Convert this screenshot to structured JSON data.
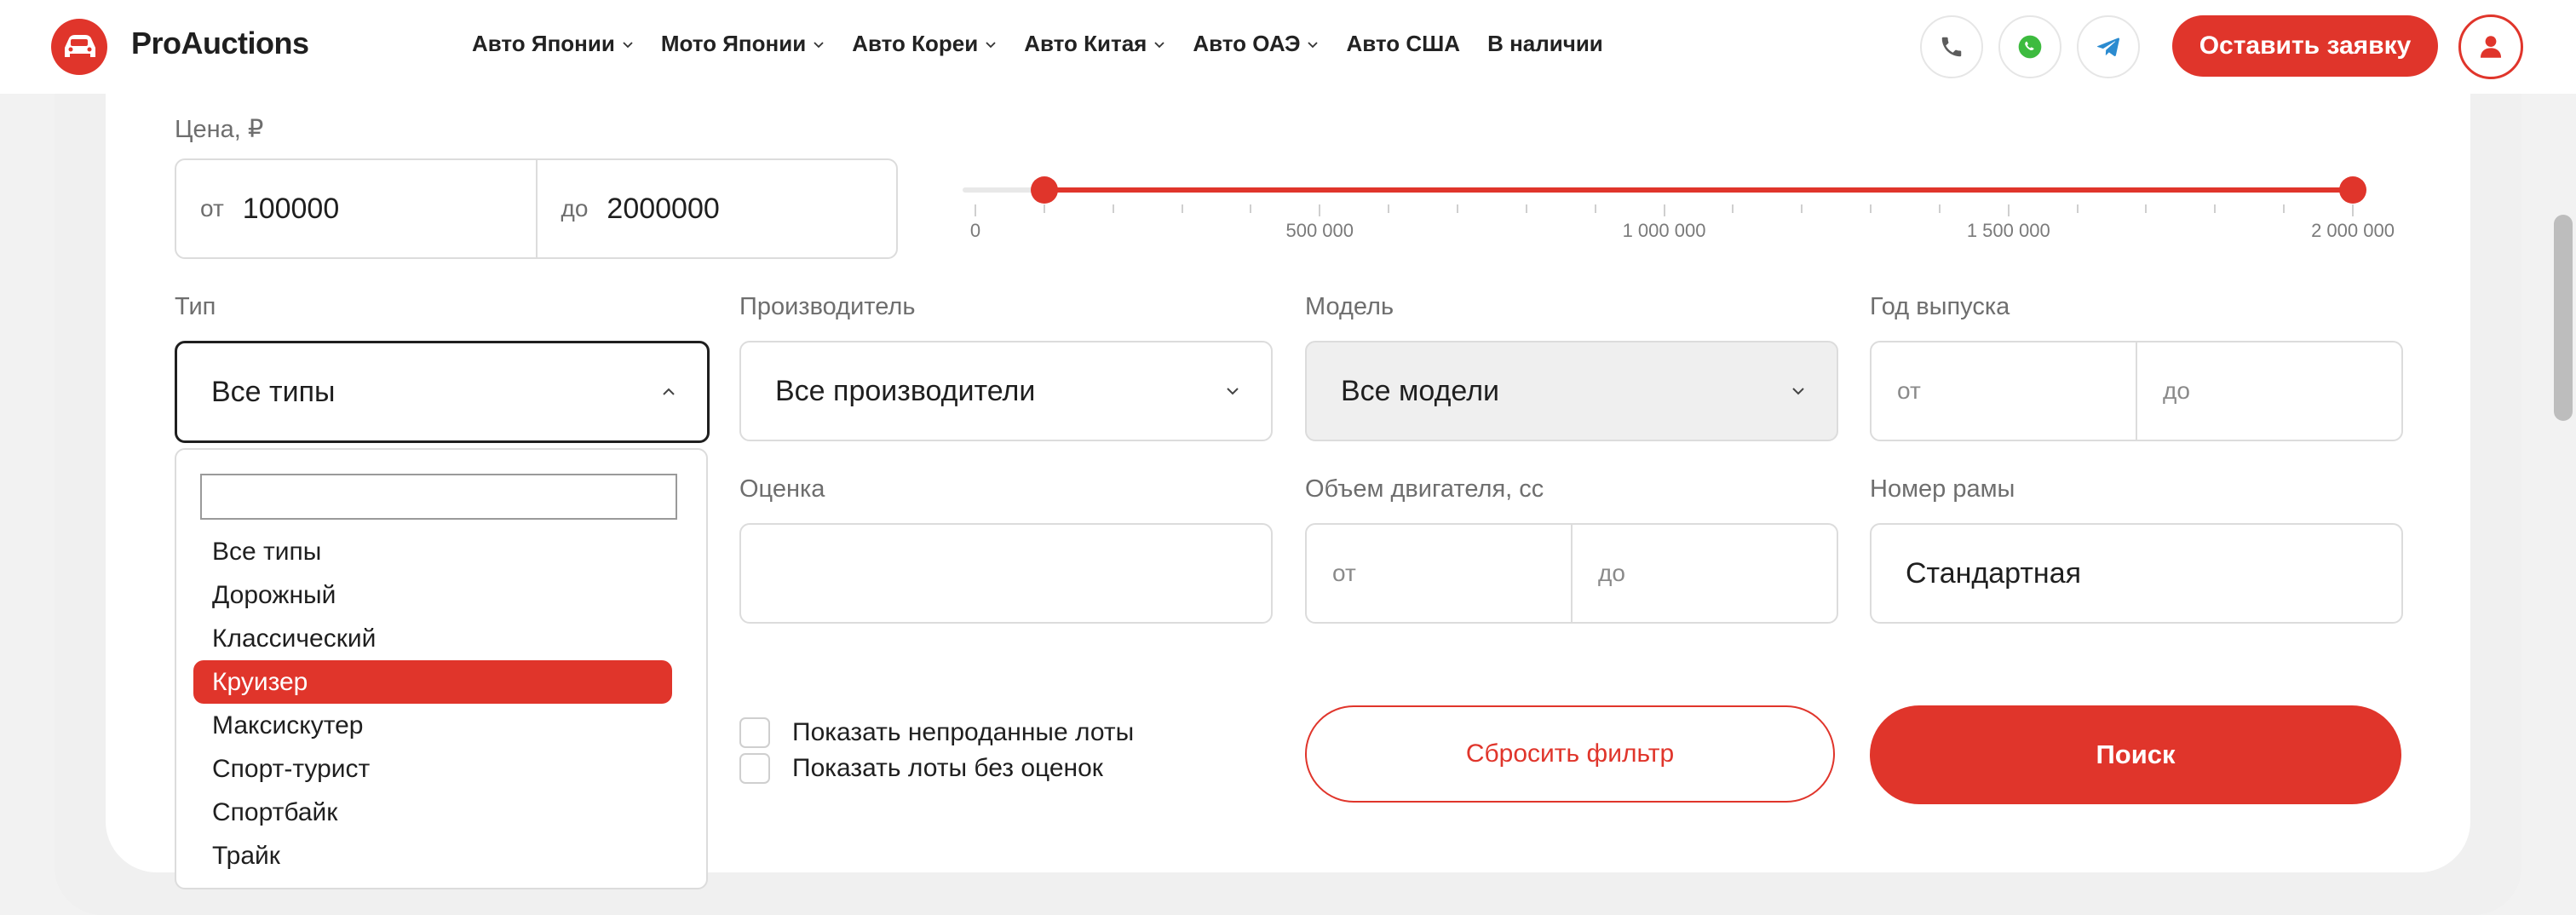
{
  "header": {
    "brand": "ProAuctions",
    "nav": [
      {
        "label": "Авто Японии",
        "dropdown": true
      },
      {
        "label": "Мото Японии",
        "dropdown": true
      },
      {
        "label": "Авто Кореи",
        "dropdown": true
      },
      {
        "label": "Авто Китая",
        "dropdown": true
      },
      {
        "label": "Авто ОАЭ",
        "dropdown": true
      },
      {
        "label": "Авто США",
        "dropdown": false
      },
      {
        "label": "В наличии",
        "dropdown": false
      }
    ],
    "contact_icons": [
      "phone-icon",
      "whatsapp-icon",
      "telegram-icon"
    ],
    "cta_label": "Оставить заявку"
  },
  "filters": {
    "price": {
      "label": "Цена, ₽",
      "from_prefix": "от",
      "from_value": "100000",
      "to_prefix": "до",
      "to_value": "2000000"
    },
    "slider": {
      "min": 0,
      "max": 2000000,
      "low": 100000,
      "high": 2000000,
      "tick_labels": [
        "0",
        "500 000",
        "1 000 000",
        "1 500 000",
        "2 000 000"
      ]
    },
    "type": {
      "label": "Тип",
      "value": "Все типы",
      "open": true
    },
    "manufacturer": {
      "label": "Производитель",
      "value": "Все производители"
    },
    "model": {
      "label": "Модель",
      "value": "Все модели",
      "disabled": true
    },
    "year": {
      "label": "Год выпуска",
      "from_placeholder": "от",
      "to_placeholder": "до"
    },
    "grade": {
      "label": "Оценка",
      "value": ""
    },
    "engine": {
      "label": "Объем двигателя, cc",
      "from_placeholder": "от",
      "to_placeholder": "до"
    },
    "frame": {
      "label": "Номер рамы",
      "value": "Стандартная"
    },
    "dropdown_options": [
      "Все типы",
      "Дорожный",
      "Классический",
      "Круизер",
      "Максискутер",
      "Спорт-турист",
      "Спортбайк",
      "Трайк"
    ],
    "dropdown_selected": "Круизер",
    "checkboxes": [
      {
        "label": "Показать непроданные лоты",
        "checked": false
      },
      {
        "label": "Показать лоты без оценок",
        "checked": false
      }
    ],
    "reset_label": "Сбросить фильтр",
    "search_label": "Поиск"
  },
  "colors": {
    "accent": "#e0352b",
    "whatsapp": "#3dbb3f",
    "telegram": "#2b8bd0"
  }
}
